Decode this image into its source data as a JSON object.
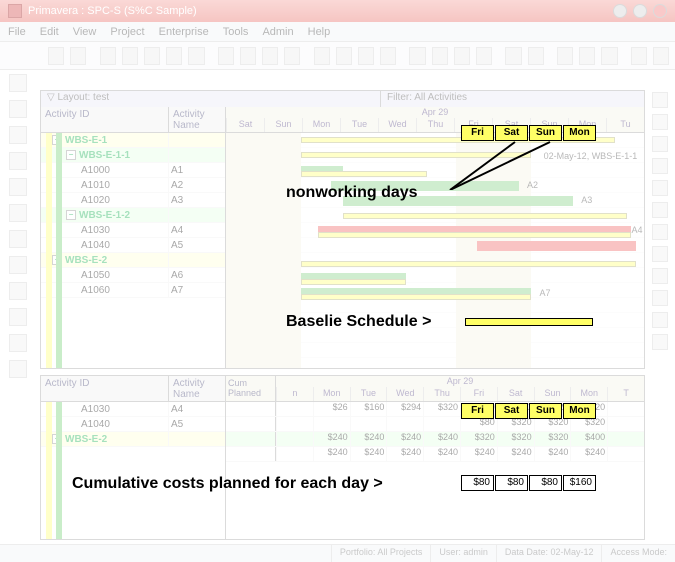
{
  "window": {
    "title": "Primavera : SPC-S (S%C Sample)"
  },
  "menu": [
    "File",
    "Edit",
    "View",
    "Project",
    "Enterprise",
    "Tools",
    "Admin",
    "Help"
  ],
  "upper_panel": {
    "layout_label": "Layout: test",
    "filter_label": "Filter: All Activities",
    "col_id": "Activity ID",
    "col_name": "Activity Name",
    "month": "Apr 29",
    "days": [
      "Sat",
      "Sun",
      "Mon",
      "Tue",
      "Wed",
      "Thu",
      "Fri",
      "Sat",
      "Sun",
      "Mon",
      "Tu"
    ],
    "rows": [
      {
        "type": "wbs1",
        "id": "WBS-E-1",
        "indent": 0
      },
      {
        "type": "wbs2",
        "id": "WBS-E-1-1",
        "indent": 1
      },
      {
        "type": "act",
        "id": "A1000",
        "name": "A1"
      },
      {
        "type": "act",
        "id": "A1010",
        "name": "A2"
      },
      {
        "type": "act",
        "id": "A1020",
        "name": "A3"
      },
      {
        "type": "wbs2",
        "id": "WBS-E-1-2",
        "indent": 1
      },
      {
        "type": "act",
        "id": "A1030",
        "name": "A4"
      },
      {
        "type": "act",
        "id": "A1040",
        "name": "A5"
      },
      {
        "type": "wbs1",
        "id": "WBS-E-2",
        "indent": 0
      },
      {
        "type": "act",
        "id": "A1050",
        "name": "A6"
      },
      {
        "type": "act",
        "id": "A1060",
        "name": "A7"
      }
    ],
    "gantt_labels": {
      "wbs1": "02-May-12, WBS-E-1-1",
      "a2": "A2",
      "a3": "A3",
      "a4": "A4",
      "a7": "A7"
    }
  },
  "lower_panel": {
    "col_id": "Activity ID",
    "col_name": "Activity Name",
    "cum_label": "Cum\nPlanned",
    "month": "Apr 29",
    "days": [
      "n",
      "Mon",
      "Tue",
      "Wed",
      "Thu",
      "Fri",
      "Sat",
      "Sun",
      "Mon",
      "T"
    ],
    "rows": [
      {
        "type": "act",
        "id": "A1030",
        "name": "A4"
      },
      {
        "type": "act",
        "id": "A1040",
        "name": "A5"
      },
      {
        "type": "wbs1",
        "id": "WBS-E-2",
        "indent": 0
      }
    ],
    "costs": [
      [
        "",
        "$26",
        "$160",
        "$294",
        "$320",
        "$320",
        "$320",
        "$320",
        "$320",
        ""
      ],
      [
        "",
        "",
        "",
        "",
        "",
        "$80",
        "$320",
        "$320",
        "$320",
        ""
      ],
      [
        "",
        "$240",
        "$240",
        "$240",
        "$240",
        "$320",
        "$320",
        "$320",
        "$400",
        ""
      ],
      [
        "",
        "$240",
        "$240",
        "$240",
        "$240",
        "$240",
        "$240",
        "$240",
        "$240",
        ""
      ]
    ]
  },
  "statusbar": {
    "portfolio": "Portfolio: All Projects",
    "user": "User: admin",
    "date": "Data Date: 02-May-12",
    "access": "Access Mode: "
  },
  "annotations": {
    "nonworking": "nonworking days",
    "baseline": "Baselie Schedule >",
    "cumulative": "Cumulative costs planned for each day >",
    "hilite_days": [
      "Fri",
      "Sat",
      "Sun",
      "Mon"
    ],
    "hilite_days2": [
      "Fri",
      "Sat",
      "Sun",
      "Mon"
    ],
    "hilite_costs": [
      "$80",
      "$80",
      "$80",
      "$160"
    ]
  }
}
